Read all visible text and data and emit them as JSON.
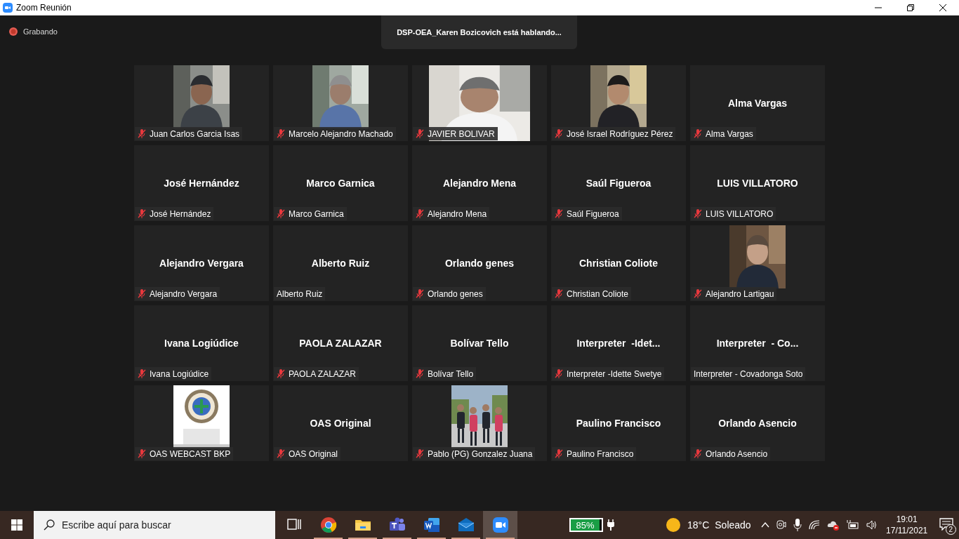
{
  "window": {
    "title": "Zoom Reunión"
  },
  "recording": {
    "label": "Grabando"
  },
  "speaker_banner": "DSP-OEA_Karen Bozicovich está hablando...",
  "tiles": [
    {
      "kind": "picture",
      "name": "Juan Carlos Garcia Isas",
      "muted": true
    },
    {
      "kind": "picture",
      "name": "Marcelo Alejandro Machado",
      "muted": true
    },
    {
      "kind": "video",
      "name": "JAVIER BOLIVAR",
      "muted": true
    },
    {
      "kind": "picture",
      "name": "José Israel Rodríguez Pérez",
      "muted": true
    },
    {
      "kind": "name",
      "display_name": "Alma Vargas",
      "name": "Alma Vargas",
      "muted": true
    },
    {
      "kind": "name",
      "display_name": "José Hernández",
      "name": "José Hernández",
      "muted": true
    },
    {
      "kind": "name",
      "display_name": "Marco Garnica",
      "name": "Marco Garnica",
      "muted": true
    },
    {
      "kind": "name",
      "display_name": "Alejandro Mena",
      "name": "Alejandro Mena",
      "muted": true
    },
    {
      "kind": "name",
      "display_name": "Saúl Figueroa",
      "name": "Saúl Figueroa",
      "muted": true
    },
    {
      "kind": "name",
      "display_name": "LUIS VILLATORO",
      "name": "LUIS VILLATORO",
      "muted": true
    },
    {
      "kind": "name",
      "display_name": "Alejandro Vergara",
      "name": "Alejandro Vergara",
      "muted": true
    },
    {
      "kind": "name",
      "display_name": "Alberto Ruiz",
      "name": "Alberto Ruiz",
      "muted": false
    },
    {
      "kind": "name",
      "display_name": "Orlando genes",
      "name": "Orlando genes",
      "muted": true
    },
    {
      "kind": "name",
      "display_name": "Christian Coliote",
      "name": "Christian Coliote",
      "muted": true
    },
    {
      "kind": "picture",
      "name": "Alejandro Lartigau",
      "muted": true
    },
    {
      "kind": "name",
      "display_name": "Ivana Logiúdice",
      "name": "Ivana Logiúdice",
      "muted": true
    },
    {
      "kind": "name",
      "display_name": "PAOLA ZALAZAR",
      "name": "PAOLA ZALAZAR",
      "muted": true
    },
    {
      "kind": "name",
      "display_name": "Bolívar Tello",
      "name": "Bolívar Tello",
      "muted": true
    },
    {
      "kind": "name",
      "display_name": "Interpreter  -Idet...",
      "name": "Interpreter -Idette Swetye",
      "muted": true
    },
    {
      "kind": "name",
      "display_name": "Interpreter  - Co...",
      "name": "Interpreter - Covadonga Soto",
      "muted": false
    },
    {
      "kind": "picture",
      "name": "OAS WEBCAST BKP",
      "muted": true
    },
    {
      "kind": "name",
      "display_name": "OAS Original",
      "name": "OAS Original",
      "muted": true
    },
    {
      "kind": "picture",
      "name": "Pablo (PG) Gonzalez Juana",
      "muted": true
    },
    {
      "kind": "name",
      "display_name": "Paulino Francisco",
      "name": "Paulino Francisco",
      "muted": true
    },
    {
      "kind": "name",
      "display_name": "Orlando Asencio",
      "name": "Orlando Asencio",
      "muted": true
    }
  ],
  "taskbar": {
    "search": {
      "placeholder": "Escribe aquí para buscar"
    },
    "apps": [
      {
        "kind": "taskview",
        "selected": false
      },
      {
        "kind": "chrome",
        "selected": false
      },
      {
        "kind": "folder",
        "selected": false
      },
      {
        "kind": "teams",
        "selected": false
      },
      {
        "kind": "word",
        "selected": false
      },
      {
        "kind": "mail",
        "selected": false
      },
      {
        "kind": "zoom",
        "selected": true
      }
    ],
    "battery": "85%",
    "weather": {
      "temperature": "18°C",
      "condition": "Soleado"
    },
    "time": "19:01",
    "date": "17/11/2021",
    "notifications": "2"
  }
}
